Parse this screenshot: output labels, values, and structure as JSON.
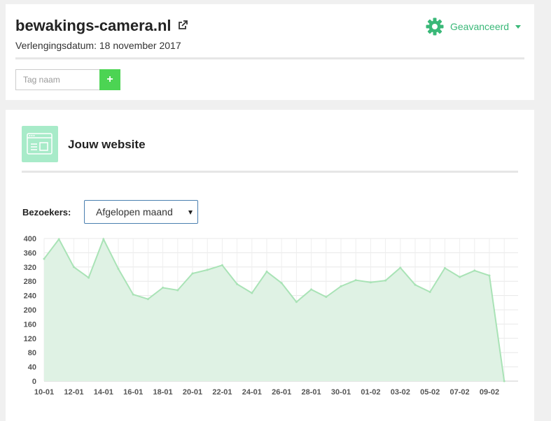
{
  "header": {
    "domain": "bewakings-camera.nl",
    "renewal": "Verlengingsdatum: 18 november 2017",
    "advanced_label": "Geavanceerd",
    "tag_placeholder": "Tag naam",
    "add_symbol": "+"
  },
  "website": {
    "title": "Jouw website",
    "visitors_label": "Bezoekers:",
    "period_selected": "Afgelopen maand"
  },
  "colors": {
    "accent": "#3ab878",
    "add_button": "#4cd453",
    "chart_line": "#a9e3b6",
    "chart_fill": "#dff2e4"
  },
  "chart_data": {
    "type": "area",
    "x": [
      "10-01",
      "11-01",
      "12-01",
      "13-01",
      "14-01",
      "15-01",
      "16-01",
      "17-01",
      "18-01",
      "19-01",
      "20-01",
      "21-01",
      "22-01",
      "23-01",
      "24-01",
      "25-01",
      "26-01",
      "27-01",
      "28-01",
      "29-01",
      "30-01",
      "31-01",
      "01-02",
      "02-02",
      "03-02",
      "04-02",
      "05-02",
      "06-02",
      "07-02",
      "08-02",
      "09-02",
      "10-02"
    ],
    "x_tick_labels": [
      "10-01",
      "12-01",
      "14-01",
      "16-01",
      "18-01",
      "20-01",
      "22-01",
      "24-01",
      "26-01",
      "28-01",
      "30-01",
      "01-02",
      "03-02",
      "05-02",
      "07-02",
      "09-02"
    ],
    "series": [
      {
        "values": [
          343,
          398,
          320,
          290,
          398,
          315,
          243,
          230,
          262,
          255,
          302,
          312,
          325,
          272,
          247,
          307,
          275,
          222,
          257,
          236,
          266,
          283,
          277,
          282,
          318,
          270,
          250,
          317,
          292,
          310,
          296,
          0
        ]
      }
    ],
    "ylim": [
      0,
      400
    ],
    "y_ticks": [
      0,
      40,
      80,
      120,
      160,
      200,
      240,
      280,
      320,
      360,
      400
    ],
    "grid": true
  }
}
